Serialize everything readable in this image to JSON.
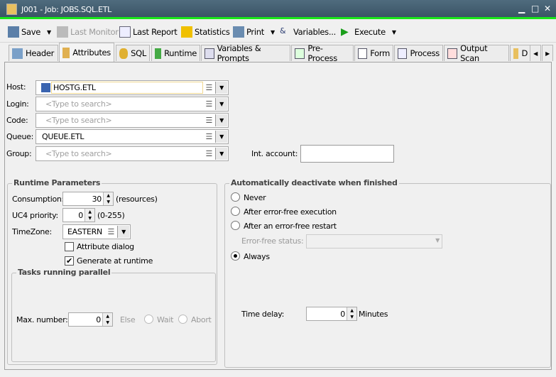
{
  "window": {
    "title": "J001 - Job: JOBS.SQL.ETL",
    "controls": [
      "minimize",
      "maximize",
      "close"
    ]
  },
  "toolbar": {
    "save": "Save",
    "last_monitor": "Last Monitor",
    "last_report": "Last Report",
    "statistics": "Statistics",
    "print": "Print",
    "variables": "Variables...",
    "execute": "Execute"
  },
  "tabs": [
    "Header",
    "Attributes",
    "SQL",
    "Runtime",
    "Variables & Prompts",
    "Pre-Process",
    "Form",
    "Process",
    "Output Scan",
    "D"
  ],
  "active_tab": "Attributes",
  "form": {
    "host": {
      "label": "Host:",
      "value": "HOSTG.ETL"
    },
    "login": {
      "label": "Login:",
      "placeholder": "<Type to search>"
    },
    "code": {
      "label": "Code:",
      "placeholder": "<Type to search>"
    },
    "queue": {
      "label": "Queue:",
      "value": "QUEUE.ETL"
    },
    "group": {
      "label": "Group:",
      "placeholder": "<Type to search>"
    },
    "int_account": {
      "label": "Int. account:",
      "value": ""
    }
  },
  "runtime": {
    "title": "Runtime Parameters",
    "consumption_label": "Consumption:",
    "consumption": "30",
    "consumption_unit": "(resources)",
    "priority_label": "UC4 priority:",
    "priority": "0",
    "priority_range": "(0-255)",
    "timezone_label": "TimeZone:",
    "timezone": "EASTERN",
    "attribute_dialog": "Attribute dialog",
    "attribute_dialog_checked": false,
    "generate_runtime": "Generate at runtime",
    "generate_runtime_checked": true
  },
  "parallel": {
    "title": "Tasks running parallel",
    "max_label": "Max. number:",
    "max": "0",
    "else": "Else",
    "wait": "Wait",
    "abort": "Abort"
  },
  "deactivate": {
    "title": "Automatically deactivate when finished",
    "options": [
      "Never",
      "After error-free execution",
      "After an error-free restart"
    ],
    "error_status_label": "Error-free status:",
    "always": "Always",
    "selected": "Always",
    "delay_label": "Time delay:",
    "delay": "0",
    "delay_unit": "Minutes"
  }
}
